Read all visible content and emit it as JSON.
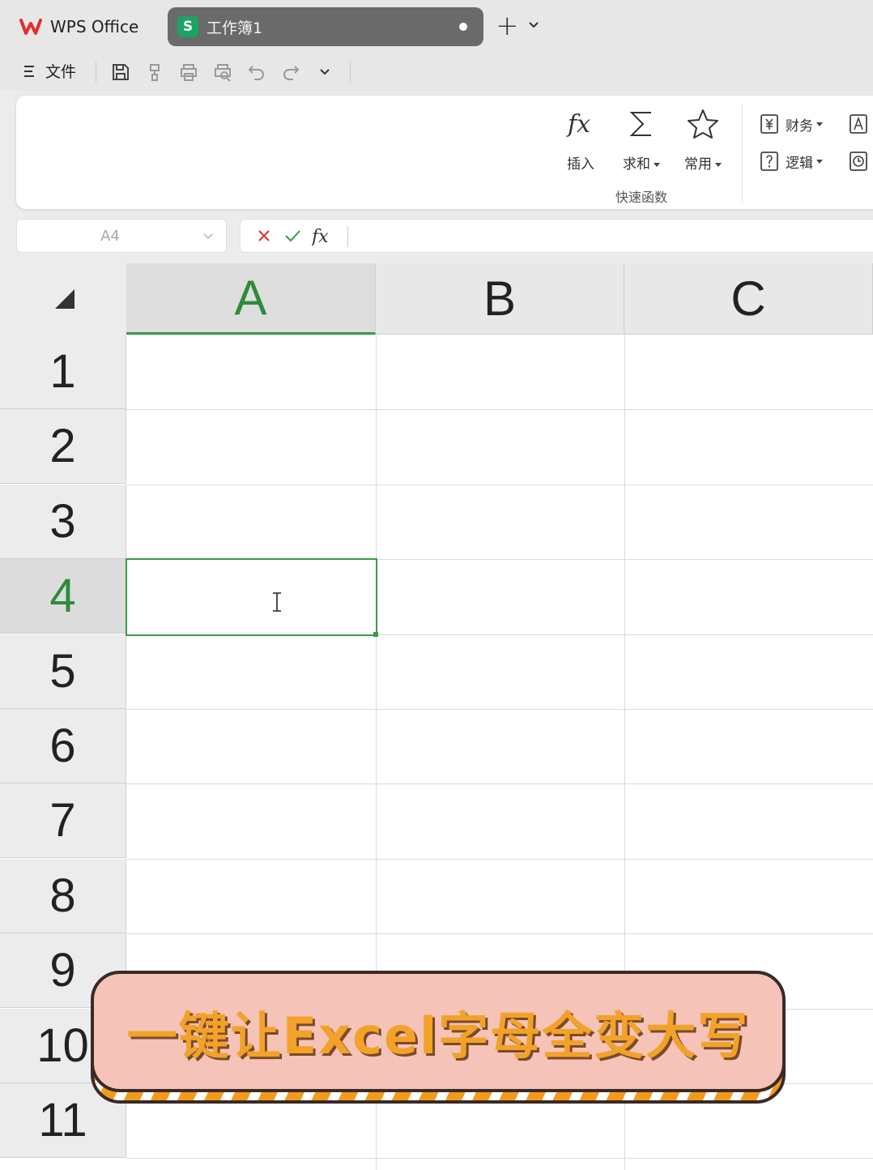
{
  "tabs": {
    "home_label": "WPS Office",
    "doc_label": "工作簿1",
    "sheet_badge": "S"
  },
  "toolbar": {
    "file_menu": "文件"
  },
  "ribbon": {
    "insert_label": "插入",
    "sum_label": "求和",
    "common_label": "常用",
    "group_label": "快速函数",
    "finance_label": "财务",
    "logic_label": "逻辑"
  },
  "namebox": {
    "value": "A4"
  },
  "formula_bar": {
    "fx": "fx"
  },
  "grid": {
    "columns": [
      "A",
      "B",
      "C"
    ],
    "rows": [
      "1",
      "2",
      "3",
      "4",
      "5",
      "6",
      "7",
      "8",
      "9",
      "10",
      "11"
    ],
    "active_cell": "A4"
  },
  "banner": {
    "text": "一键让Excel字母全变大写"
  },
  "colors": {
    "accent_green": "#3a9a47",
    "wps_red": "#e0312e",
    "banner_text": "#f2a229"
  }
}
